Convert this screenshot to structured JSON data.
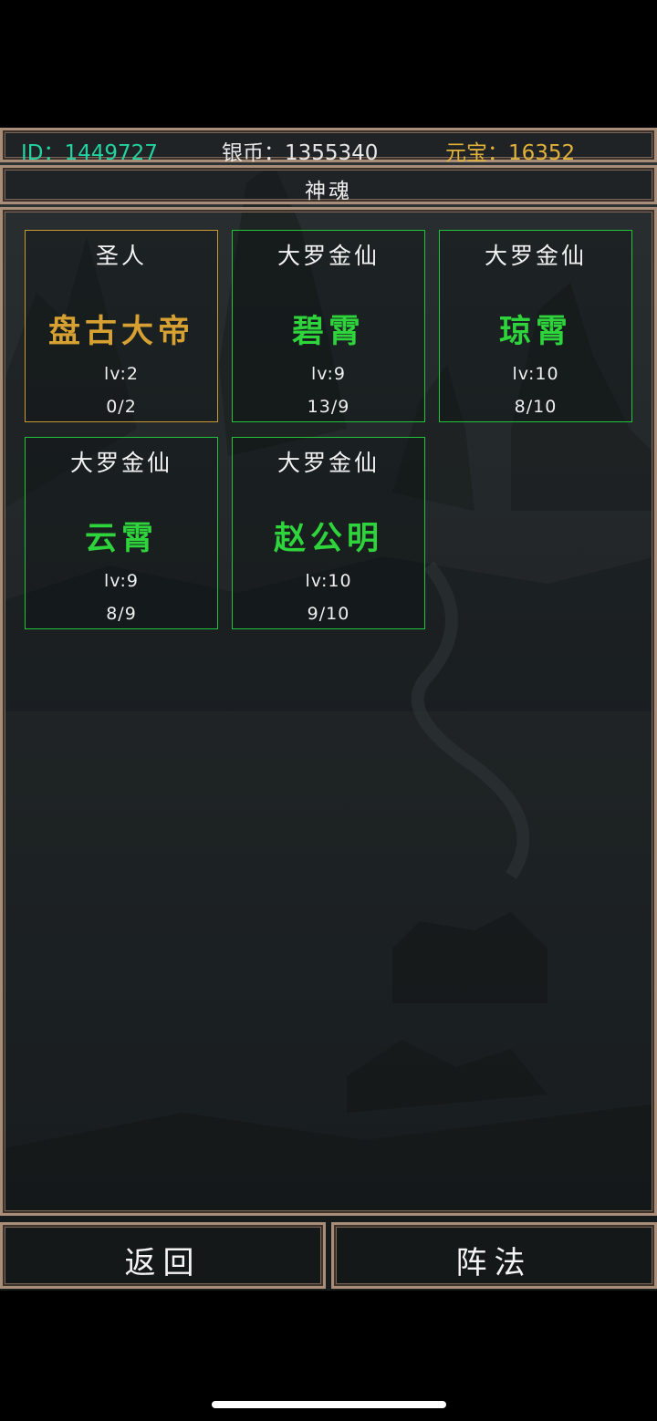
{
  "status_bar": {
    "id_text": "ID：1449727",
    "silver_text": "银币：1355340",
    "gold_text": "元宝：16352"
  },
  "title": "神魂",
  "cards": [
    {
      "rank": "圣人",
      "name": "盘古大帝",
      "level": "lv:2",
      "progress": "0/2",
      "tier": "gold"
    },
    {
      "rank": "大罗金仙",
      "name": "碧霄",
      "level": "lv:9",
      "progress": "13/9",
      "tier": "green"
    },
    {
      "rank": "大罗金仙",
      "name": "琼霄",
      "level": "lv:10",
      "progress": "8/10",
      "tier": "green"
    },
    {
      "rank": "大罗金仙",
      "name": "云霄",
      "level": "lv:9",
      "progress": "8/9",
      "tier": "green"
    },
    {
      "rank": "大罗金仙",
      "name": "赵公明",
      "level": "lv:10",
      "progress": "9/10",
      "tier": "green"
    }
  ],
  "buttons": {
    "back": "返回",
    "formation": "阵法"
  },
  "colors": {
    "id": "#23d2a0",
    "gold": "#e0b23a",
    "green_border": "#21c43a",
    "gold_border": "#c79a33",
    "frame": "#a88d78"
  }
}
